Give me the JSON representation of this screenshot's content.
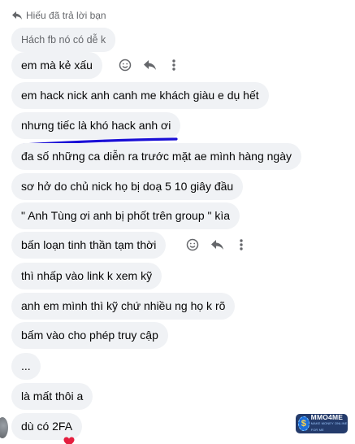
{
  "reply_header": {
    "text": "Hiếu đã trả lời bạn",
    "icon": "reply-icon"
  },
  "quoted_message": "Hách fb nó có dễ k",
  "messages": [
    {
      "text": "em mà kẻ xấu",
      "actions": [
        "smile-icon",
        "reply-icon",
        "more-icon"
      ]
    },
    {
      "text": "em hack nick anh canh me khách giàu e dụ hết"
    },
    {
      "text": "nhưng tiếc là khó hack anh ơi",
      "highlight": "blue-underline"
    },
    {
      "text": "đa số những ca diễn ra trước mặt ae mình hàng ngày"
    },
    {
      "text": "sơ hở do chủ nick họ bị doạ 5 10 giây đầu"
    },
    {
      "text": "\" Anh Tùng ơi anh bị phốt trên group \" kìa"
    },
    {
      "text": "bấn loạn tinh thần tạm thời",
      "actions": [
        "smile-icon",
        "reply-icon",
        "more-icon"
      ]
    },
    {
      "text": "thì nhấp vào link k xem kỹ"
    },
    {
      "text": "anh em mình thì kỹ chứ nhiều ng họ k rõ"
    },
    {
      "text": "bấm vào cho phép truy cập"
    },
    {
      "text": "..."
    },
    {
      "text": "là mất thôi a"
    },
    {
      "text": "dù có 2FA",
      "reaction": "heart"
    }
  ],
  "watermark": {
    "title": "MMO4ME",
    "subtitle": "MAKE MONEY ONLINE FOR ME"
  },
  "colors": {
    "bubble": "#f0f2f5",
    "text": "#050505",
    "muted": "#65676b",
    "underline": "#1a0fd6",
    "reaction": "#e41e3f"
  }
}
